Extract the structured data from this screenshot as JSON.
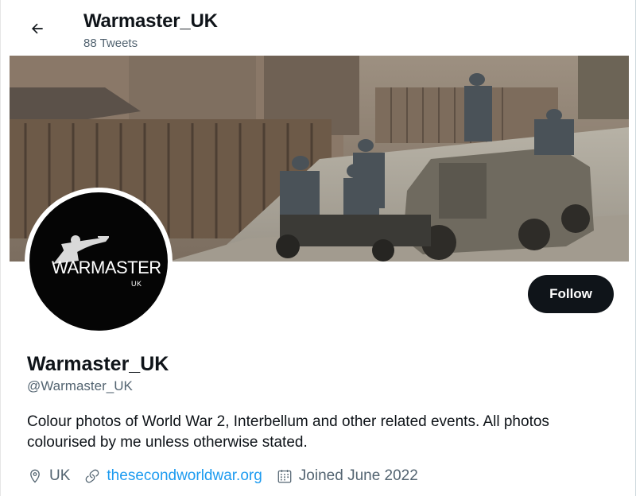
{
  "header": {
    "title": "Warmaster_UK",
    "tweet_count": "88 Tweets"
  },
  "avatar": {
    "brand": "WARMASTER",
    "sub": "UK"
  },
  "profile": {
    "follow_label": "Follow",
    "display_name": "Warmaster_UK",
    "handle": "@Warmaster_UK",
    "bio": "Colour photos of World War 2, Interbellum and other related events. All photos colourised by me unless otherwise stated.",
    "location": "UK",
    "website": "thesecondworldwar.org",
    "joined": "Joined June 2022"
  },
  "icons": {
    "back": "arrow-left-icon",
    "location": "location-pin-icon",
    "link": "link-icon",
    "calendar": "calendar-icon"
  },
  "colors": {
    "text_primary": "#0f1419",
    "text_secondary": "#536471",
    "link": "#1d9bf0",
    "button_bg": "#0f1419"
  }
}
